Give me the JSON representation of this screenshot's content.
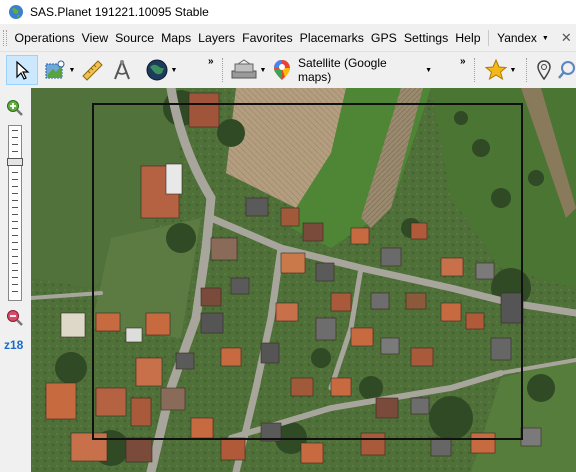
{
  "window": {
    "title": "SAS.Planet 191221.10095 Stable",
    "icon": "earth-icon"
  },
  "menu": {
    "items": [
      "Operations",
      "View",
      "Source",
      "Maps",
      "Layers",
      "Favorites",
      "Placemarks",
      "GPS",
      "Settings",
      "Help"
    ],
    "search_provider": "Yandex",
    "close_glyph": "✕"
  },
  "toolbar": {
    "current_map": "Satellite (Google maps)",
    "tools": [
      "select-cursor-icon",
      "layer-select-icon",
      "ruler-icon",
      "compass-icon",
      "globe-icon",
      "satellite-icon",
      "google-maps-icon",
      "favorite-star-icon",
      "placemark-icon",
      "search-icon"
    ],
    "more_glyph": "»"
  },
  "zoom": {
    "level_label": "z18",
    "zoom_in": "zoom-in-icon",
    "zoom_out": "zoom-out-icon",
    "slider_fraction": 0.19
  },
  "colors": {
    "accent": "#1a6ccc",
    "selection": "#cce8ff",
    "frame": "#111111"
  }
}
